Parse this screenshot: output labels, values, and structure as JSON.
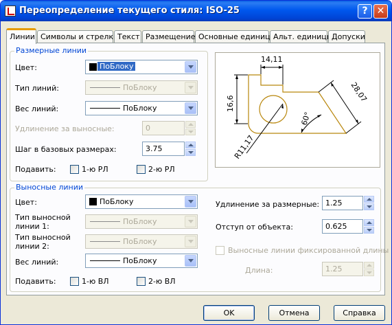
{
  "window": {
    "title": "Переопределение текущего стиля: ISO-25",
    "help_glyph": "?",
    "close_glyph": "✕"
  },
  "tabs": [
    "Линии",
    "Символы и стрелки",
    "Текст",
    "Размещение",
    "Основные единицы",
    "Альт. единицы",
    "Допуски"
  ],
  "dim_lines": {
    "legend": "Размерные линии",
    "color_label": "Цвет:",
    "color_value": "ПоБлоку",
    "linetype_label": "Тип линий:",
    "linetype_value": "ПоБлоку",
    "lineweight_label": "Вес линий:",
    "lineweight_value": "ПоБлоку",
    "extend_label": "Удлинение за выносные:",
    "extend_value": "0",
    "baseline_label": "Шаг в базовых размерах:",
    "baseline_value": "3.75",
    "suppress_label": "Подавить:",
    "suppress_1": "1-ю РЛ",
    "suppress_2": "2-ю РЛ"
  },
  "ext_lines": {
    "legend": "Выносные линии",
    "color_label": "Цвет:",
    "color_value": "ПоБлоку",
    "linetype1_label_a": "Тип выносной",
    "linetype1_label_b": "линии 1:",
    "linetype1_value": "ПоБлоку",
    "linetype2_label_a": "Тип выносной",
    "linetype2_label_b": "линии 2:",
    "linetype2_value": "ПоБлоку",
    "lineweight_label": "Вес линий:",
    "lineweight_value": "ПоБлоку",
    "suppress_label": "Подавить:",
    "suppress_1": "1-ю ВЛ",
    "suppress_2": "2-ю ВЛ",
    "extend_label": "Удлинение за размерные:",
    "extend_value": "1.25",
    "offset_label": "Отступ от объекта:",
    "offset_value": "0.625",
    "fixed_label": "Выносные линии фиксированной длины",
    "length_label": "Длина:",
    "length_value": "1.25"
  },
  "preview": {
    "dim_top": "14,11",
    "dim_left": "16,6",
    "dim_right": "28,07",
    "dim_angle": "60°",
    "dim_radius": "R11,17",
    "accent": "#b8860b"
  },
  "buttons": {
    "ok": "OK",
    "cancel": "Отмена",
    "help": "Справка"
  }
}
